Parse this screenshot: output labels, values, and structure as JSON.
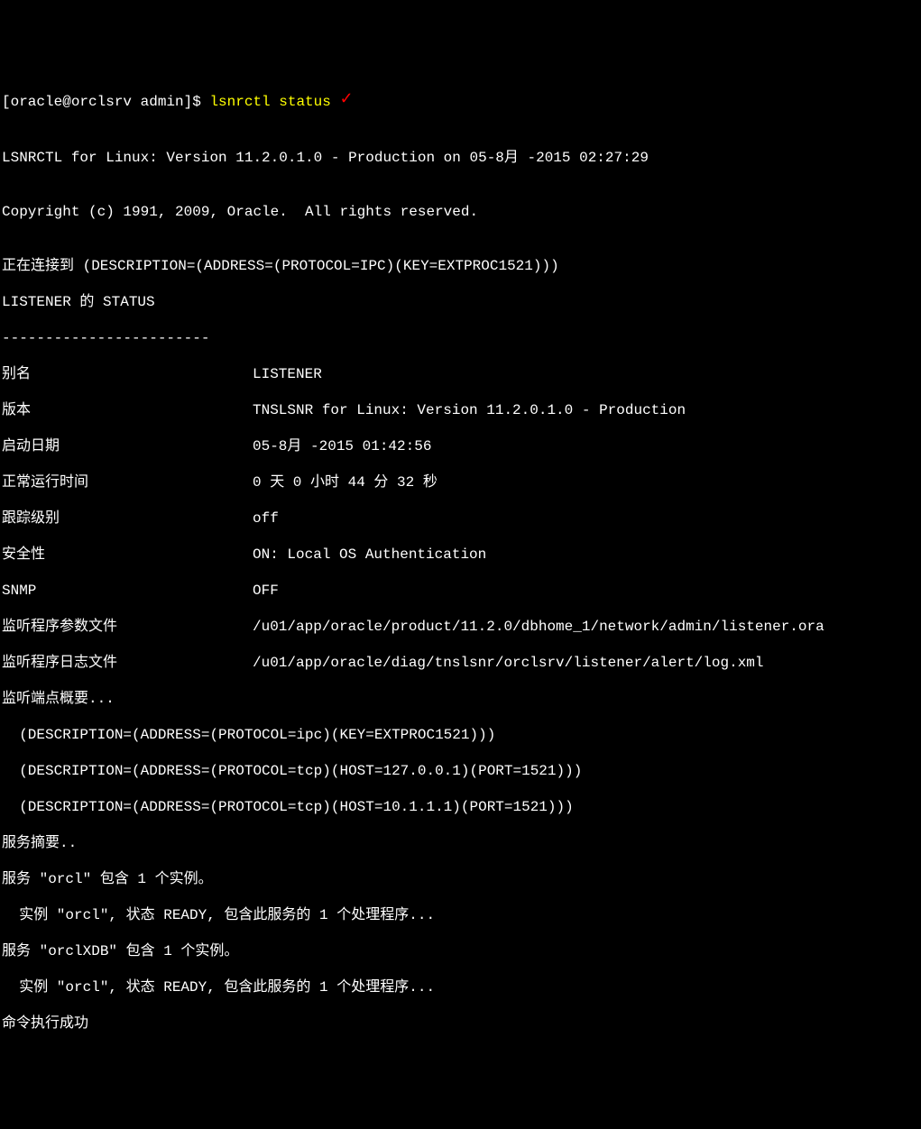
{
  "prompt": "[oracle@orclsrv admin]$ ",
  "command": "lsnrctl status",
  "checkmark": "✓",
  "blank": "",
  "header1": "LSNRCTL for Linux: Version 11.2.0.1.0 - Production on 05-8月 -2015 02:27:29",
  "copyright": "Copyright (c) 1991, 2009, Oracle.  All rights reserved.",
  "connecting": "正在连接到 (DESCRIPTION=(ADDRESS=(PROTOCOL=IPC)(KEY=EXTPROC1521)))",
  "status_header": "LISTENER 的 STATUS",
  "divider": "------------------------",
  "rows": {
    "alias": {
      "label": "别名",
      "value": "LISTENER"
    },
    "version": {
      "label": "版本",
      "value": "TNSLSNR for Linux: Version 11.2.0.1.0 - Production"
    },
    "startdate": {
      "label": "启动日期",
      "value": "05-8月 -2015 01:42:56"
    },
    "uptime": {
      "label": "正常运行时间",
      "value": "0 天 0 小时 44 分 32 秒"
    },
    "trace": {
      "label": "跟踪级别",
      "value": "off"
    },
    "security": {
      "label": "安全性",
      "value": "ON: Local OS Authentication"
    },
    "snmp": {
      "label": "SNMP",
      "value": "OFF"
    },
    "paramfile": {
      "label": "监听程序参数文件",
      "value": "/u01/app/oracle/product/11.2.0/dbhome_1/network/admin/listener.ora"
    },
    "logfile": {
      "label": "监听程序日志文件",
      "value": "/u01/app/oracle/diag/tnslsnr/orclsrv/listener/alert/log.xml"
    }
  },
  "endpoint_summary": "监听端点概要...",
  "endpoint1": "  (DESCRIPTION=(ADDRESS=(PROTOCOL=ipc)(KEY=EXTPROC1521)))",
  "endpoint2": "  (DESCRIPTION=(ADDRESS=(PROTOCOL=tcp)(HOST=127.0.0.1)(PORT=1521)))",
  "endpoint3": "  (DESCRIPTION=(ADDRESS=(PROTOCOL=tcp)(HOST=10.1.1.1)(PORT=1521)))",
  "service_summary": "服务摘要..",
  "service1": "服务 \"orcl\" 包含 1 个实例。",
  "instance1": "  实例 \"orcl\", 状态 READY, 包含此服务的 1 个处理程序...",
  "service2": "服务 \"orclXDB\" 包含 1 个实例。",
  "instance2": "  实例 \"orcl\", 状态 READY, 包含此服务的 1 个处理程序...",
  "success": "命令执行成功"
}
